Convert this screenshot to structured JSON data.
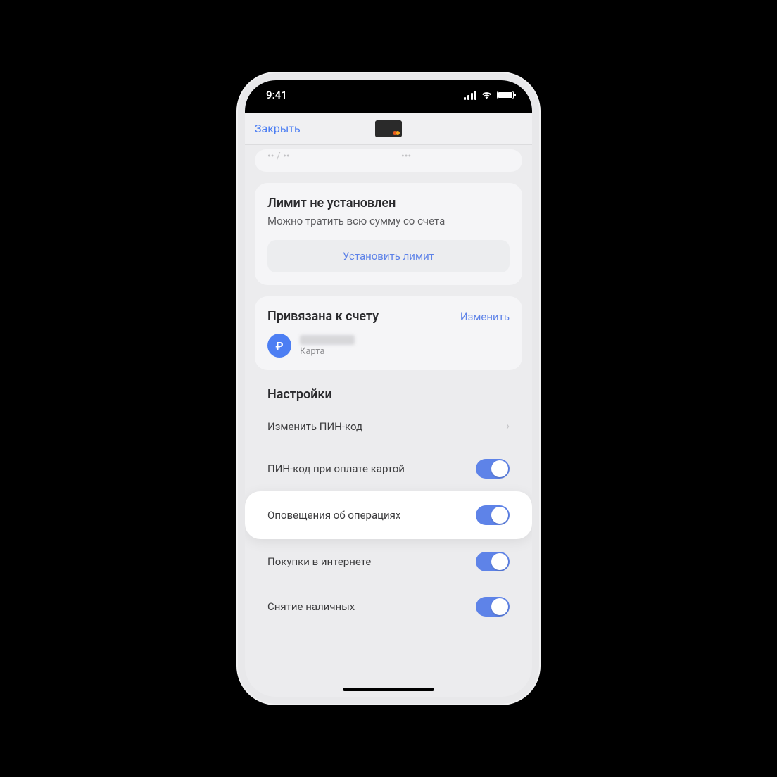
{
  "status": {
    "time": "9:41"
  },
  "nav": {
    "close": "Закрыть"
  },
  "masked": {
    "expiry": "•• / ••",
    "cvv": "•••"
  },
  "limit": {
    "title": "Лимит не установлен",
    "subtitle": "Можно тратить всю сумму со счета",
    "button": "Установить лимит"
  },
  "linked": {
    "title": "Привязана к счету",
    "change": "Изменить",
    "account_label": "Карта"
  },
  "settings": {
    "title": "Настройки",
    "change_pin": "Изменить ПИН-код",
    "pin_on_pay": "ПИН-код при оплате картой",
    "notifications": "Оповещения об операциях",
    "online": "Покупки в интернете",
    "cash": "Снятие наличных"
  }
}
